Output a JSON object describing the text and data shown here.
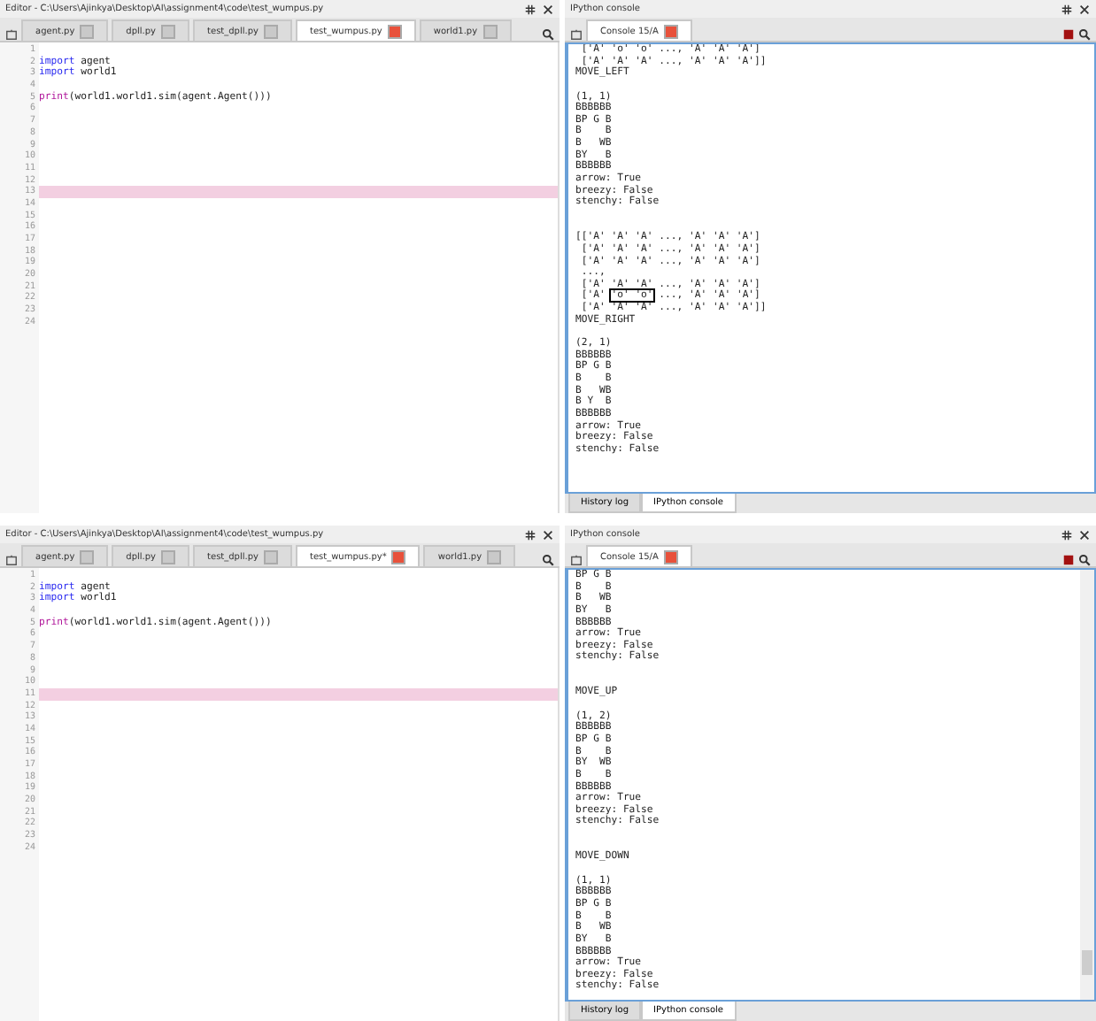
{
  "screens": [
    {
      "editor": {
        "title": "Editor - C:\\Users\\Ajinkya\\Desktop\\AI\\assignment4\\code\\test_wumpus.py",
        "tabs": [
          {
            "label": "agent.py",
            "selected": false
          },
          {
            "label": "dpll.py",
            "selected": false
          },
          {
            "label": "test_dpll.py",
            "selected": false
          },
          {
            "label": "test_wumpus.py",
            "selected": true
          },
          {
            "label": "world1.py",
            "selected": false
          }
        ],
        "lines": [
          {
            "number": "1",
            "current": false
          },
          {
            "number": "2",
            "current": false,
            "code": [
              {
                "kind": "keyword",
                "text": "import"
              },
              {
                "kind": "plain",
                "text": " agent"
              }
            ]
          },
          {
            "number": "3",
            "current": false,
            "code": [
              {
                "kind": "keyword",
                "text": "import"
              },
              {
                "kind": "plain",
                "text": " world1"
              }
            ]
          },
          {
            "number": "4",
            "current": false
          },
          {
            "number": "5",
            "current": false,
            "code": [
              {
                "kind": "builtin",
                "text": "print"
              },
              {
                "kind": "plain",
                "text": "(world1.world1.sim(agent.Agent()))"
              }
            ]
          },
          {
            "number": "6",
            "current": false
          },
          {
            "number": "7",
            "current": false
          },
          {
            "number": "8",
            "current": false
          },
          {
            "number": "9",
            "current": false
          },
          {
            "number": "10",
            "current": false
          },
          {
            "number": "11",
            "current": false
          },
          {
            "number": "12",
            "current": false
          },
          {
            "number": "13",
            "current": true
          },
          {
            "number": "14",
            "current": false
          },
          {
            "number": "15",
            "current": false
          },
          {
            "number": "16",
            "current": false
          },
          {
            "number": "17",
            "current": false
          },
          {
            "number": "18",
            "current": false
          },
          {
            "number": "19",
            "current": false
          },
          {
            "number": "20",
            "current": false
          },
          {
            "number": "21",
            "current": false
          },
          {
            "number": "22",
            "current": false
          },
          {
            "number": "23",
            "current": false
          },
          {
            "number": "24",
            "current": false
          }
        ]
      },
      "console": {
        "title": "IPython console",
        "tab": "Console 15/A",
        "scrollbar": false,
        "lines": [
          {
            "kind": "text",
            "text": " ['A' 'o' 'o' ..., 'A' 'A' 'A']"
          },
          {
            "kind": "text",
            "text": " ['A' 'A' 'A' ..., 'A' 'A' 'A']]"
          },
          {
            "kind": "text",
            "text": "MOVE_LEFT"
          },
          {
            "kind": "blank"
          },
          {
            "kind": "text",
            "text": "(1, 1)"
          },
          {
            "kind": "text",
            "text": "BBBBBB"
          },
          {
            "kind": "text",
            "text": "BP G B"
          },
          {
            "kind": "text",
            "text": "B    B"
          },
          {
            "kind": "text",
            "text": "B   WB"
          },
          {
            "kind": "text",
            "text": "BY   B"
          },
          {
            "kind": "text",
            "text": "BBBBBB"
          },
          {
            "kind": "text",
            "text": "arrow: True"
          },
          {
            "kind": "text",
            "text": "breezy: False"
          },
          {
            "kind": "text",
            "text": "stenchy: False"
          },
          {
            "kind": "blank"
          },
          {
            "kind": "blank"
          },
          {
            "kind": "text",
            "text": "[['A' 'A' 'A' ..., 'A' 'A' 'A']"
          },
          {
            "kind": "text",
            "text": " ['A' 'A' 'A' ..., 'A' 'A' 'A']"
          },
          {
            "kind": "text",
            "text": " ['A' 'A' 'A' ..., 'A' 'A' 'A']"
          },
          {
            "kind": "text",
            "text": " ...,"
          },
          {
            "kind": "text",
            "text": " ['A' 'A' 'A' ..., 'A' 'A' 'A']"
          },
          {
            "kind": "boxed",
            "pre": " ['A' ",
            "boxed": "'o' 'o'",
            "post": " ..., 'A' 'A' 'A']"
          },
          {
            "kind": "text",
            "text": " ['A' 'A' 'A' ..., 'A' 'A' 'A']]"
          },
          {
            "kind": "text",
            "text": "MOVE_RIGHT"
          },
          {
            "kind": "blank"
          },
          {
            "kind": "text",
            "text": "(2, 1)"
          },
          {
            "kind": "text",
            "text": "BBBBBB"
          },
          {
            "kind": "text",
            "text": "BP G B"
          },
          {
            "kind": "text",
            "text": "B    B"
          },
          {
            "kind": "text",
            "text": "B   WB"
          },
          {
            "kind": "text",
            "text": "B Y  B"
          },
          {
            "kind": "text",
            "text": "BBBBBB"
          },
          {
            "kind": "text",
            "text": "arrow: True"
          },
          {
            "kind": "text",
            "text": "breezy: False"
          },
          {
            "kind": "text",
            "text": "stenchy: False"
          }
        ],
        "bottom_tabs": [
          {
            "label": "History log",
            "selected": false
          },
          {
            "label": "IPython console",
            "selected": true
          }
        ]
      }
    },
    {
      "editor": {
        "title": "Editor - C:\\Users\\Ajinkya\\Desktop\\AI\\assignment4\\code\\test_wumpus.py",
        "tabs": [
          {
            "label": "agent.py",
            "selected": false
          },
          {
            "label": "dpll.py",
            "selected": false
          },
          {
            "label": "test_dpll.py",
            "selected": false
          },
          {
            "label": "test_wumpus.py*",
            "selected": true
          },
          {
            "label": "world1.py",
            "selected": false
          }
        ],
        "lines": [
          {
            "number": "1",
            "current": false
          },
          {
            "number": "2",
            "current": false,
            "code": [
              {
                "kind": "keyword",
                "text": "import"
              },
              {
                "kind": "plain",
                "text": " agent"
              }
            ]
          },
          {
            "number": "3",
            "current": false,
            "code": [
              {
                "kind": "keyword",
                "text": "import"
              },
              {
                "kind": "plain",
                "text": " world1"
              }
            ]
          },
          {
            "number": "4",
            "current": false
          },
          {
            "number": "5",
            "current": false,
            "code": [
              {
                "kind": "builtin",
                "text": "print"
              },
              {
                "kind": "plain",
                "text": "(world1.world1.sim(agent.Agent()))"
              }
            ]
          },
          {
            "number": "6",
            "current": false
          },
          {
            "number": "7",
            "current": false
          },
          {
            "number": "8",
            "current": false
          },
          {
            "number": "9",
            "current": false
          },
          {
            "number": "10",
            "current": false
          },
          {
            "number": "11",
            "current": true
          },
          {
            "number": "12",
            "current": false
          },
          {
            "number": "13",
            "current": false
          },
          {
            "number": "14",
            "current": false
          },
          {
            "number": "15",
            "current": false
          },
          {
            "number": "16",
            "current": false
          },
          {
            "number": "17",
            "current": false
          },
          {
            "number": "18",
            "current": false
          },
          {
            "number": "19",
            "current": false
          },
          {
            "number": "20",
            "current": false
          },
          {
            "number": "21",
            "current": false
          },
          {
            "number": "22",
            "current": false
          },
          {
            "number": "23",
            "current": false
          },
          {
            "number": "24",
            "current": false
          }
        ]
      },
      "console": {
        "title": "IPython console",
        "tab": "Console 15/A",
        "scrollbar": true,
        "lines": [
          {
            "kind": "text",
            "text": "BP G B"
          },
          {
            "kind": "text",
            "text": "B    B"
          },
          {
            "kind": "text",
            "text": "B   WB"
          },
          {
            "kind": "text",
            "text": "BY   B"
          },
          {
            "kind": "text",
            "text": "BBBBBB"
          },
          {
            "kind": "text",
            "text": "arrow: True"
          },
          {
            "kind": "text",
            "text": "breezy: False"
          },
          {
            "kind": "text",
            "text": "stenchy: False"
          },
          {
            "kind": "blank"
          },
          {
            "kind": "blank"
          },
          {
            "kind": "text",
            "text": "MOVE_UP"
          },
          {
            "kind": "blank"
          },
          {
            "kind": "text",
            "text": "(1, 2)"
          },
          {
            "kind": "text",
            "text": "BBBBBB"
          },
          {
            "kind": "text",
            "text": "BP G B"
          },
          {
            "kind": "text",
            "text": "B    B"
          },
          {
            "kind": "text",
            "text": "BY  WB"
          },
          {
            "kind": "text",
            "text": "B    B"
          },
          {
            "kind": "text",
            "text": "BBBBBB"
          },
          {
            "kind": "text",
            "text": "arrow: True"
          },
          {
            "kind": "text",
            "text": "breezy: False"
          },
          {
            "kind": "text",
            "text": "stenchy: False"
          },
          {
            "kind": "blank"
          },
          {
            "kind": "blank"
          },
          {
            "kind": "text",
            "text": "MOVE_DOWN"
          },
          {
            "kind": "blank"
          },
          {
            "kind": "text",
            "text": "(1, 1)"
          },
          {
            "kind": "text",
            "text": "BBBBBB"
          },
          {
            "kind": "text",
            "text": "BP G B"
          },
          {
            "kind": "text",
            "text": "B    B"
          },
          {
            "kind": "text",
            "text": "B   WB"
          },
          {
            "kind": "text",
            "text": "BY   B"
          },
          {
            "kind": "text",
            "text": "BBBBBB"
          },
          {
            "kind": "text",
            "text": "arrow: True"
          },
          {
            "kind": "text",
            "text": "breezy: False"
          },
          {
            "kind": "text",
            "text": "stenchy: False"
          }
        ],
        "bottom_tabs": [
          {
            "label": "History log",
            "selected": false
          },
          {
            "label": "IPython console",
            "selected": true
          }
        ]
      }
    }
  ]
}
